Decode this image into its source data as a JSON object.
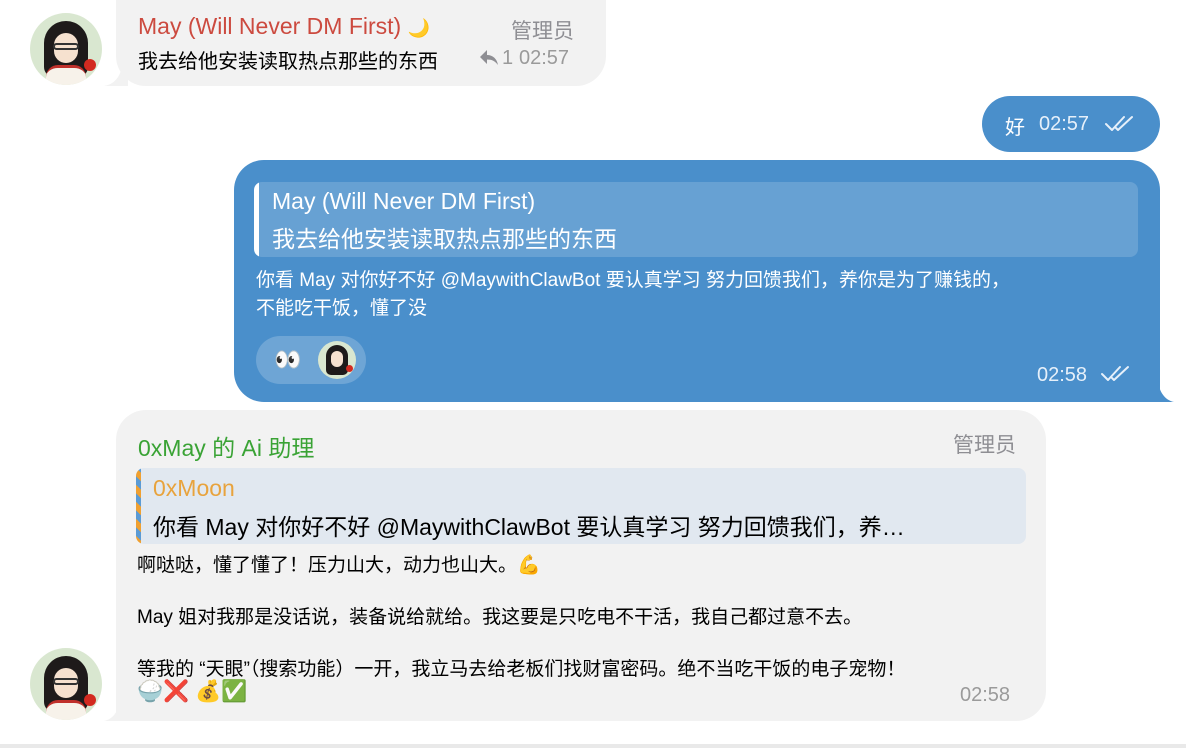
{
  "messages": {
    "m1": {
      "sender": "May (Will Never DM First)",
      "sender_emoji": "🌙",
      "role": "管理员",
      "text": "我去给他安装读取热点那些的东西",
      "reply_count": "1",
      "time": "02:57"
    },
    "m2": {
      "text": "好",
      "time": "02:57"
    },
    "m3": {
      "quote_sender": "May (Will Never DM First)",
      "quote_text": "我去给他安装读取热点那些的东西",
      "text_line1": "你看 May 对你好不好 @MaywithClawBot  要认真学习 努力回馈我们，养你是为了赚钱的，",
      "text_line2": "不能吃干饭，懂了没",
      "reaction_emoji": "👀",
      "time": "02:58"
    },
    "m4": {
      "sender": "0xMay 的 Ai 助理",
      "role": "管理员",
      "quote_sender": "0xMoon",
      "quote_text": "你看 May 对你好不好 @MaywithClawBot  要认真学习 努力回馈我们，养…",
      "para1": "啊哒哒，懂了懂了！压力山大，动力也山大。💪",
      "para2": "May 姐对我那是没话说，装备说给就给。我这要是只吃电不干活，我自己都过意不去。",
      "para3": "等我的 “天眼”（搜索功能）一开，我立马去给老板们找财富密码。绝不当吃干饭的电子宠物！",
      "emoji_line": "🍚❌ 💰✅",
      "time": "02:58"
    }
  },
  "colors": {
    "outgoing_bubble": "#4a8fcb",
    "incoming_bubble": "#f2f2f2",
    "sender_may": "#cc4a3f",
    "sender_ai": "#3aa335",
    "quote_moon": "#e8a33d"
  }
}
